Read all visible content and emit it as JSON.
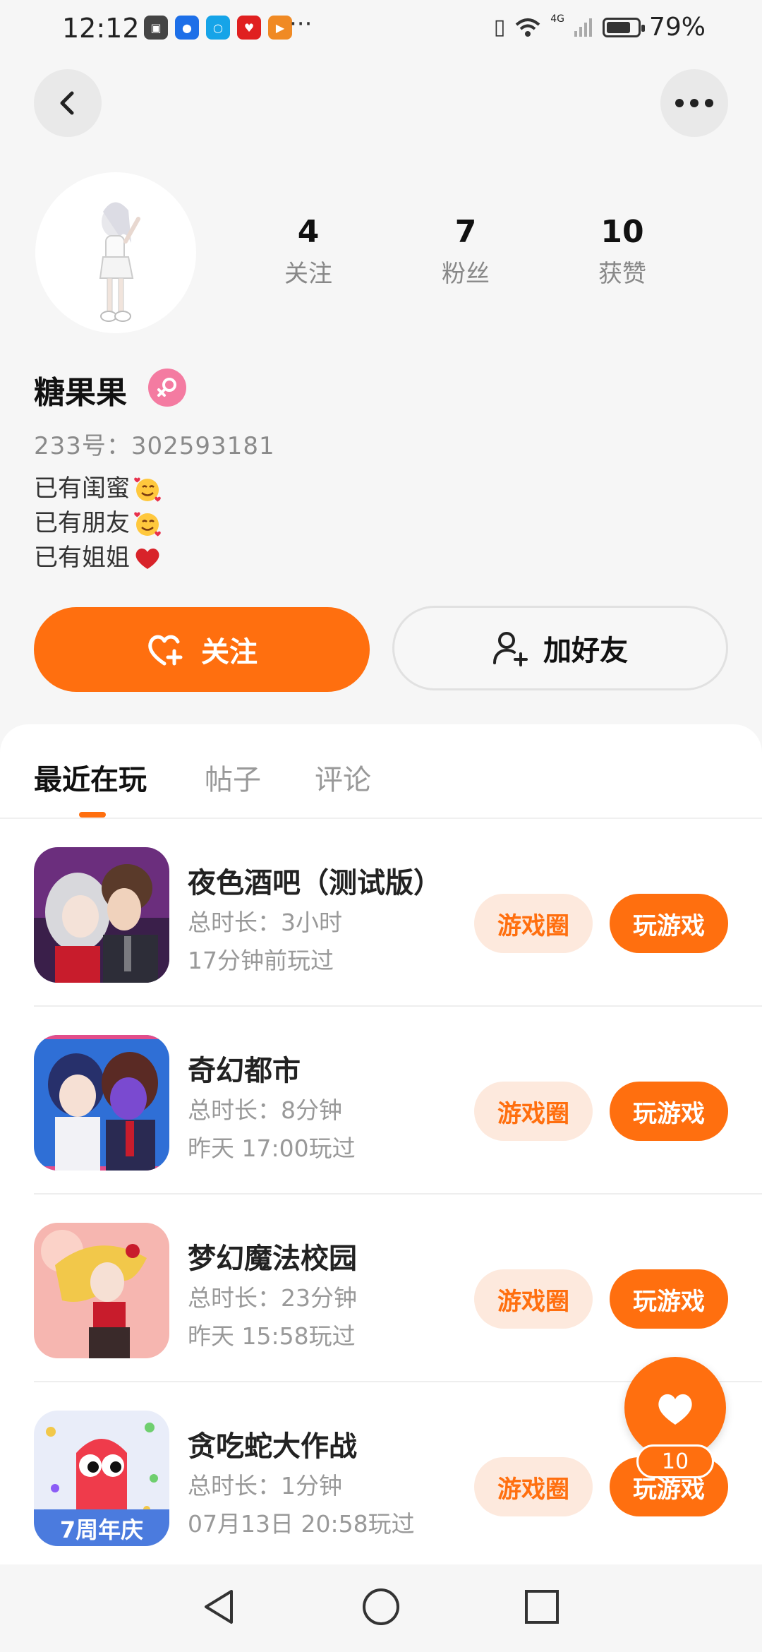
{
  "status_bar": {
    "time": "12:12",
    "more": "···",
    "network": "4G",
    "battery_text": "79%",
    "battery_level": 0.79
  },
  "profile": {
    "name": "糖果果",
    "id_text": "233号：302593181",
    "bio": [
      "已有闺蜜",
      "已有朋友",
      "已有姐姐"
    ],
    "stats": [
      {
        "value": "4",
        "label": "关注"
      },
      {
        "value": "7",
        "label": "粉丝"
      },
      {
        "value": "10",
        "label": "获赞"
      }
    ]
  },
  "actions": {
    "follow_label": "关注",
    "add_friend_label": "加好友"
  },
  "tabs": [
    "最近在玩",
    "帖子",
    "评论"
  ],
  "games": [
    {
      "name": "夜色酒吧（测试版）",
      "duration": "总时长：3小时",
      "last_played": "17分钟前玩过",
      "circle_label": "游戏圈",
      "play_label": "玩游戏"
    },
    {
      "name": "奇幻都市",
      "duration": "总时长：8分钟",
      "last_played": "昨天 17:00玩过",
      "circle_label": "游戏圈",
      "play_label": "玩游戏"
    },
    {
      "name": "梦幻魔法校园",
      "duration": "总时长：23分钟",
      "last_played": "昨天 15:58玩过",
      "circle_label": "游戏圈",
      "play_label": "玩游戏"
    },
    {
      "name": "贪吃蛇大作战",
      "duration": "总时长：1分钟",
      "last_played": "07月13日 20:58玩过",
      "circle_label": "游戏圈",
      "play_label": "玩游戏",
      "icon_badge": "7周年庆"
    }
  ],
  "floating_like": {
    "count": "10"
  },
  "colors": {
    "accent": "#ff6f0f",
    "accent_light": "#fde9dd",
    "gender_badge": "#f47ba1",
    "background": "#f6f6f6"
  }
}
